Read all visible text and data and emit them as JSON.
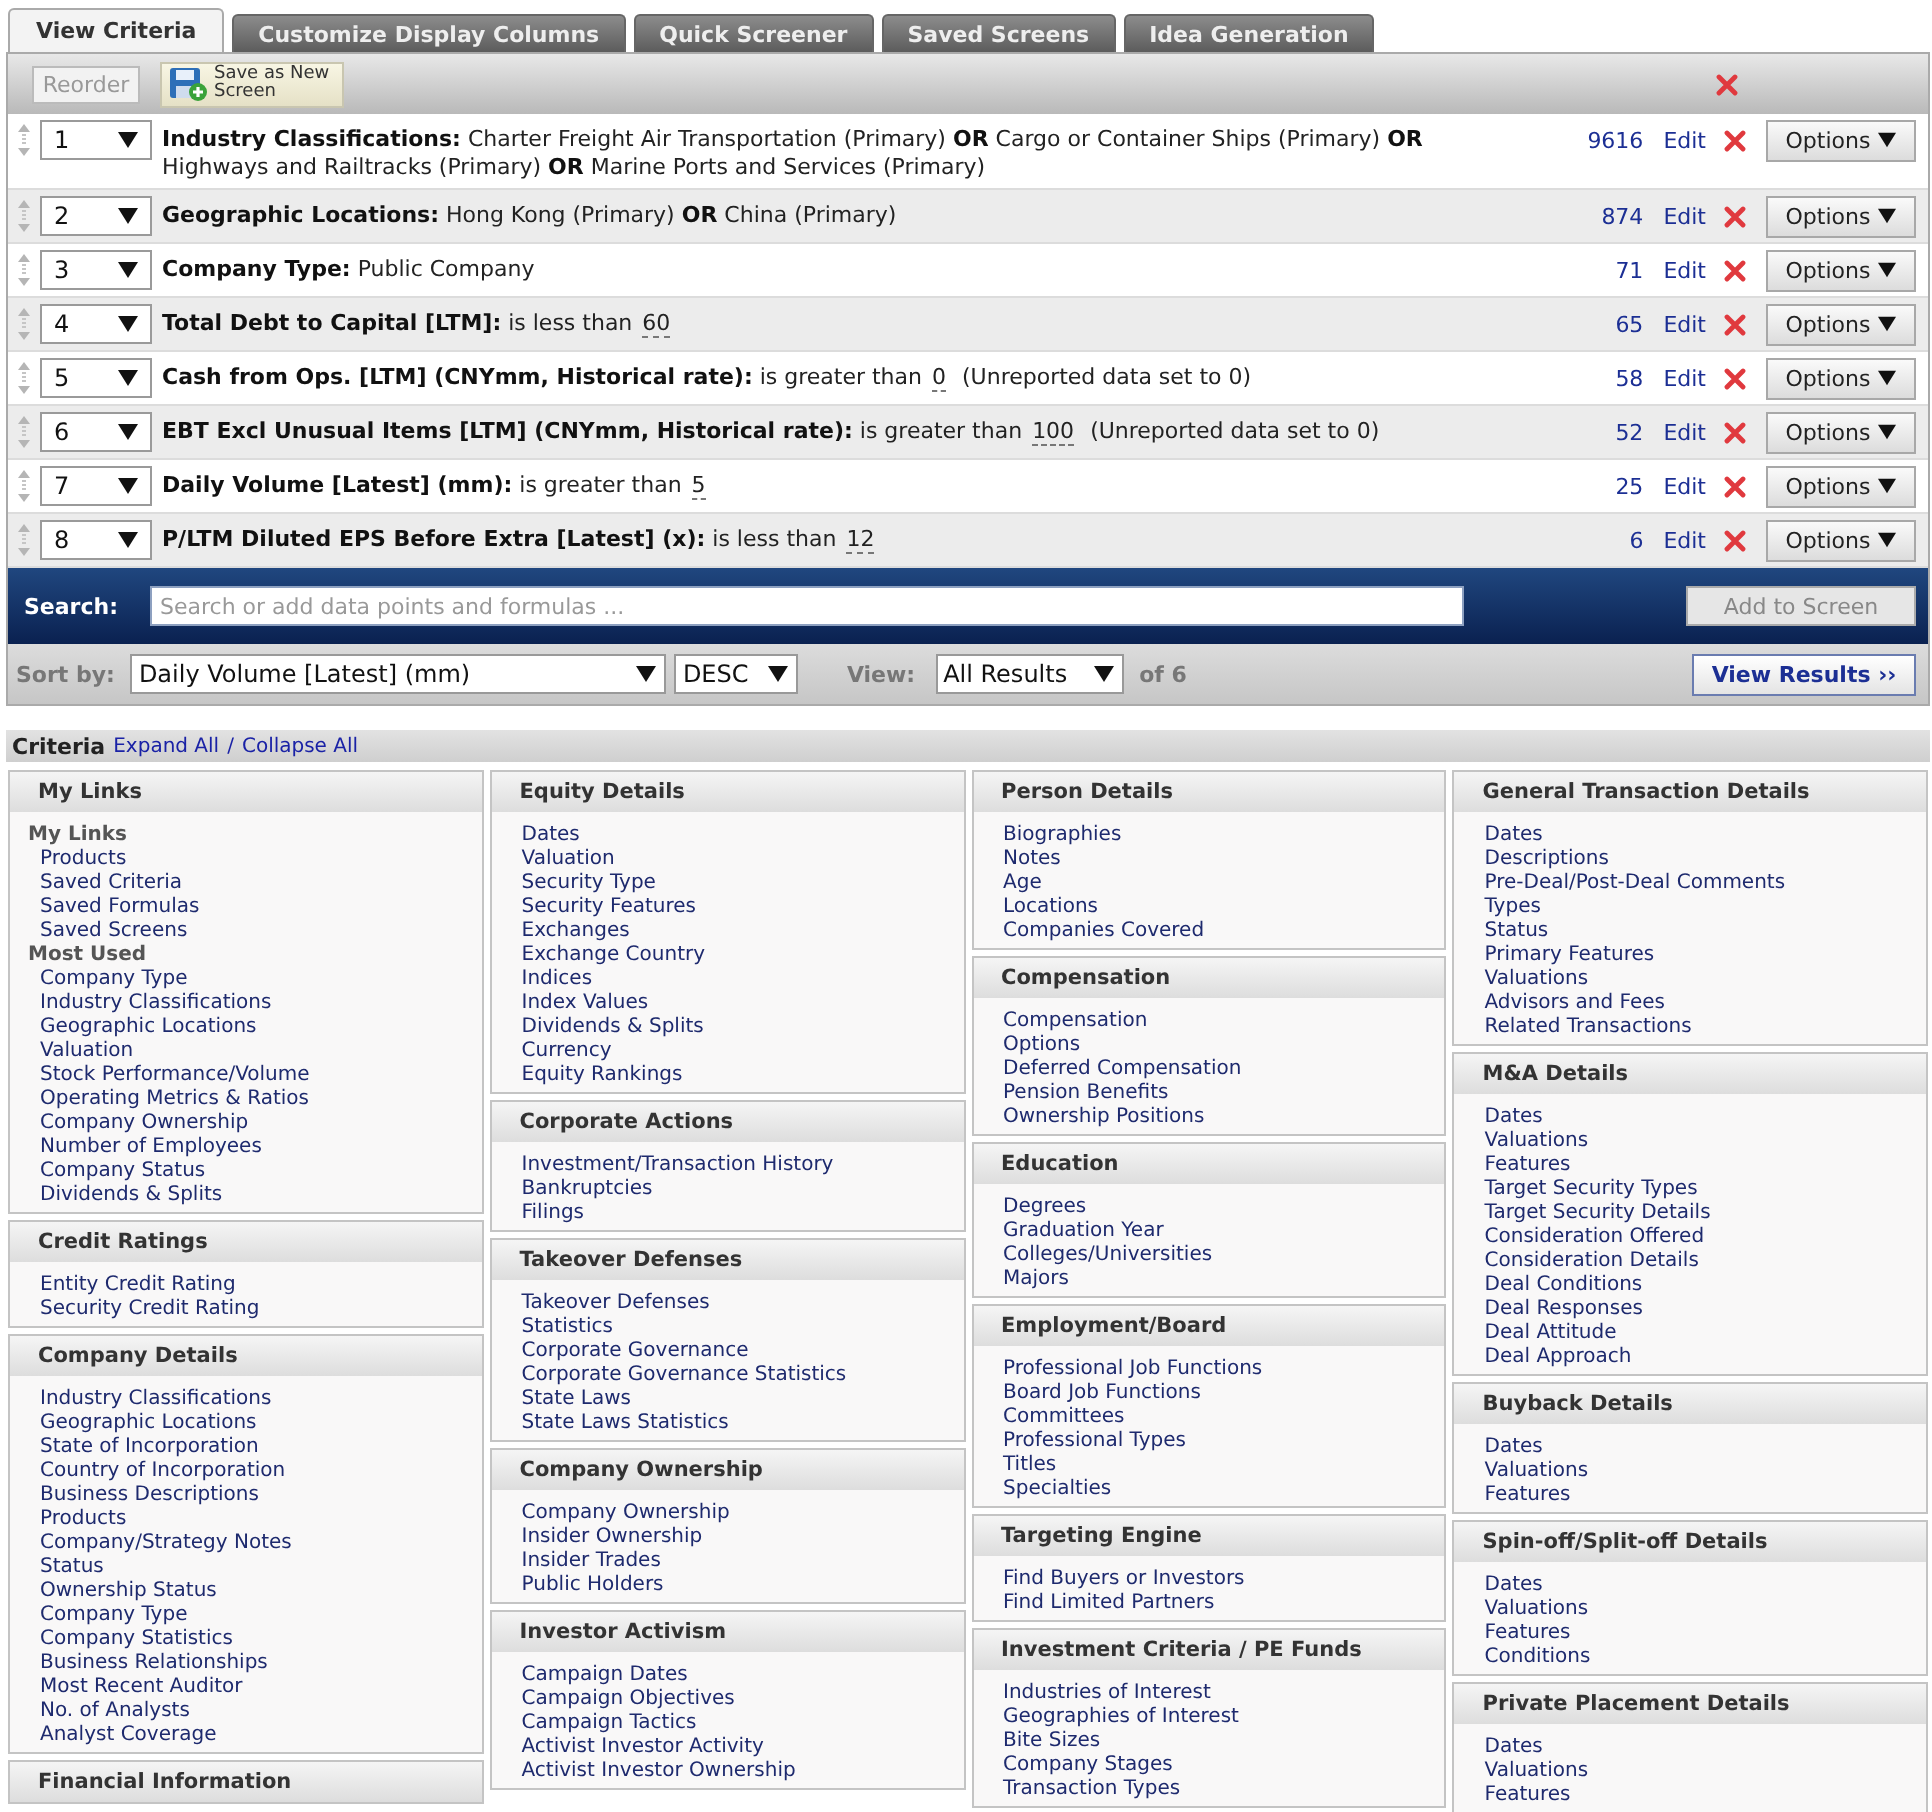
{
  "tabs": [
    {
      "label": "View Criteria",
      "selected": true
    },
    {
      "label": "Customize Display Columns",
      "selected": false
    },
    {
      "label": "Quick Screener",
      "selected": false
    },
    {
      "label": "Saved Screens",
      "selected": false
    },
    {
      "label": "Idea Generation",
      "selected": false
    }
  ],
  "toolbar": {
    "reorder": {
      "label": "Reorder",
      "disabled": true
    },
    "save": {
      "label": "Save as New Screen"
    }
  },
  "criteria_rows": [
    {
      "order": "1",
      "text": "**Industry Classifications:** Charter Freight Air Transportation (Primary) **OR** Cargo or Container Ships (Primary) **OR** Highways and Railtracks (Primary) **OR** Marine Ports and Services (Primary)",
      "count": "9616",
      "edit": "Edit",
      "options": "Options"
    },
    {
      "order": "2",
      "text": "**Geographic Locations:** Hong Kong (Primary) **OR** China (Primary)",
      "count": "874",
      "edit": "Edit",
      "options": "Options"
    },
    {
      "order": "3",
      "text": "**Company Type:** Public Company",
      "count": "71",
      "edit": "Edit",
      "options": "Options"
    },
    {
      "order": "4",
      "text": "**Total Debt to Capital [LTM]:** is less than",
      "value": "60",
      "count": "65",
      "edit": "Edit",
      "options": "Options"
    },
    {
      "order": "5",
      "text": "**Cash from Ops. [LTM] (CNYmm, Historical rate):** is greater than",
      "value": "0",
      "note": "(Unreported data set to 0)",
      "count": "58",
      "edit": "Edit",
      "options": "Options"
    },
    {
      "order": "6",
      "text": "**EBT Excl Unusual Items [LTM] (CNYmm, Historical rate):** is greater than",
      "value": "100",
      "note": "(Unreported data set to 0)",
      "count": "52",
      "edit": "Edit",
      "options": "Options"
    },
    {
      "order": "7",
      "text": "**Daily Volume [Latest] (mm):** is greater than",
      "value": "5",
      "count": "25",
      "edit": "Edit",
      "options": "Options"
    },
    {
      "order": "8",
      "text": "**P/LTM Diluted EPS Before Extra [Latest] (x):** is less than",
      "value": "12",
      "count": "6",
      "edit": "Edit",
      "options": "Options"
    }
  ],
  "search": {
    "label": "Search:",
    "placeholder": "Search or add data points and formulas ...",
    "button": {
      "label": "Add to Screen",
      "disabled": true
    }
  },
  "sort_bar": {
    "label": "Sort by:",
    "sort_field": "Daily Volume [Latest] (mm)",
    "direction": "DESC",
    "view_label": "View:",
    "view": "All Results",
    "of": "of 6",
    "button": "View Results ››"
  },
  "criteria_browser": {
    "title": "Criteria",
    "expand": "Expand All",
    "separator": "/",
    "collapse": "Collapse All",
    "columns": [
      {
        "panels": [
          {
            "title": "My Links",
            "groups": [
              {
                "heading": "My Links",
                "links": [
                  "Products",
                  "Saved Criteria",
                  "Saved Formulas",
                  "Saved Screens"
                ]
              },
              {
                "heading": "Most Used",
                "links": [
                  "Company Type",
                  "Industry Classifications",
                  "Geographic Locations",
                  "Valuation",
                  "Stock Performance/Volume",
                  "Operating Metrics & Ratios",
                  "Company Ownership",
                  "Number of Employees",
                  "Company Status",
                  "Dividends & Splits"
                ]
              }
            ]
          },
          {
            "title": "Credit Ratings",
            "links": [
              "Entity Credit Rating",
              "Security Credit Rating"
            ]
          },
          {
            "title": "Company Details",
            "links": [
              "Industry Classifications",
              "Geographic Locations",
              "State of Incorporation",
              "Country of Incorporation",
              "Business Descriptions",
              "Products",
              "Company/Strategy Notes",
              "Status",
              "Ownership Status",
              "Company Type",
              "Company Statistics",
              "Business Relationships",
              "Most Recent Auditor",
              "No. of Analysts",
              "Analyst Coverage"
            ]
          },
          {
            "title": "Financial Information"
          }
        ]
      },
      {
        "panels": [
          {
            "title": "Equity Details",
            "links": [
              "Dates",
              "Valuation",
              "Security Type",
              "Security Features",
              "Exchanges",
              "Exchange Country",
              "Indices",
              "Index Values",
              "Dividends & Splits",
              "Currency",
              "Equity Rankings"
            ]
          },
          {
            "title": "Corporate Actions",
            "links": [
              "Investment/Transaction History",
              "Bankruptcies",
              "Filings"
            ]
          },
          {
            "title": "Takeover Defenses",
            "links": [
              "Takeover Defenses",
              "Statistics",
              "Corporate Governance",
              "Corporate Governance Statistics",
              "State Laws",
              "State Laws Statistics"
            ]
          },
          {
            "title": "Company Ownership",
            "links": [
              "Company Ownership",
              "Insider Ownership",
              "Insider Trades",
              "Public Holders"
            ]
          },
          {
            "title": "Investor Activism",
            "links": [
              "Campaign Dates",
              "Campaign Objectives",
              "Campaign Tactics",
              "Activist Investor Activity",
              "Activist Investor Ownership"
            ]
          }
        ]
      },
      {
        "panels": [
          {
            "title": "Person Details",
            "links": [
              "Biographies",
              "Notes",
              "Age",
              "Locations",
              "Companies Covered"
            ]
          },
          {
            "title": "Compensation",
            "links": [
              "Compensation",
              "Options",
              "Deferred Compensation",
              "Pension Benefits",
              "Ownership Positions"
            ]
          },
          {
            "title": "Education",
            "links": [
              "Degrees",
              "Graduation Year",
              "Colleges/Universities",
              "Majors"
            ]
          },
          {
            "title": "Employment/Board",
            "links": [
              "Professional Job Functions",
              "Board Job Functions",
              "Committees",
              "Professional Types",
              "Titles",
              "Specialties"
            ]
          },
          {
            "title": "Targeting Engine",
            "links": [
              "Find Buyers or Investors",
              "Find Limited Partners"
            ]
          },
          {
            "title": "Investment Criteria / PE Funds",
            "links": [
              "Industries of Interest",
              "Geographies of Interest",
              "Bite Sizes",
              "Company Stages",
              "Transaction Types"
            ]
          }
        ]
      },
      {
        "panels": [
          {
            "title": "General Transaction Details",
            "links": [
              "Dates",
              "Descriptions",
              "Pre-Deal/Post-Deal Comments",
              "Types",
              "Status",
              "Primary Features",
              "Valuations",
              "Advisors and Fees",
              "Related Transactions"
            ]
          },
          {
            "title": "M&A Details",
            "links": [
              "Dates",
              "Valuations",
              "Features",
              "Target Security Types",
              "Target Security Details",
              "Consideration Offered",
              "Consideration Details",
              "Deal Conditions",
              "Deal Responses",
              "Deal Attitude",
              "Deal Approach"
            ]
          },
          {
            "title": "Buyback Details",
            "links": [
              "Dates",
              "Valuations",
              "Features"
            ]
          },
          {
            "title": "Spin-off/Split-off Details",
            "links": [
              "Dates",
              "Valuations",
              "Features",
              "Conditions"
            ]
          },
          {
            "title": "Private Placement Details",
            "links": [
              "Dates",
              "Valuations",
              "Features"
            ]
          }
        ]
      }
    ]
  }
}
